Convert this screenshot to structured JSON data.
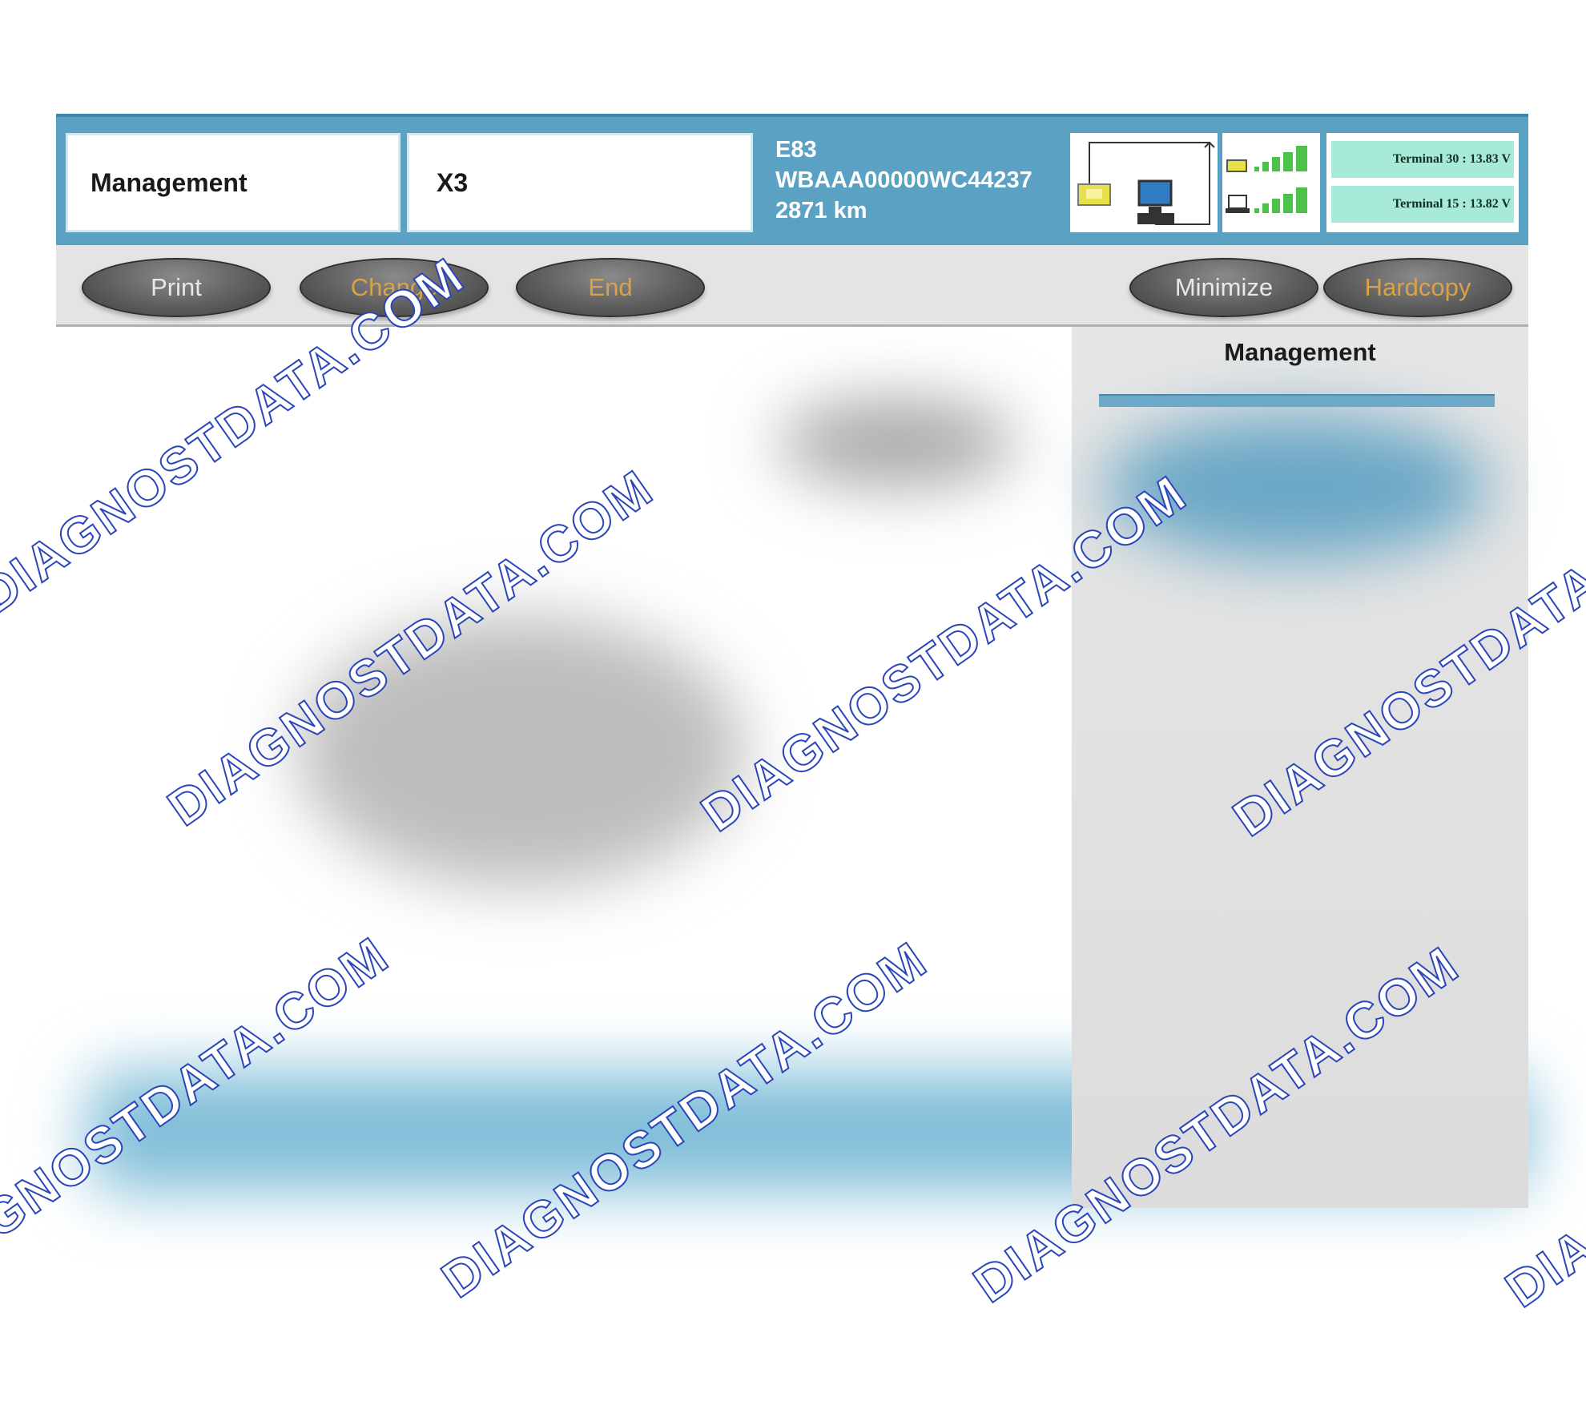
{
  "header": {
    "area_label": "Management",
    "model_label": "X3",
    "vehicle": {
      "series": "E83",
      "vin": "WBAAA00000WC44237",
      "mileage": "2871 km"
    },
    "terminal_30": "Terminal 30 : 13.83 V",
    "terminal_15": "Terminal 15 : 13.82 V"
  },
  "toolbar": {
    "print_label": "Print",
    "change_label": "Change",
    "end_label": "End",
    "minimize_label": "Minimize",
    "hardcopy_label": "Hardcopy"
  },
  "side_panel": {
    "title": "Management"
  },
  "watermark": {
    "text": "DIAGNOSTDATA.COM"
  },
  "colors": {
    "header_blue": "#5aa1c4",
    "button_text_orange": "#d8a24a",
    "terminal_green": "#a7ead9",
    "signal_green": "#4cc24a",
    "watermark_outline": "#2b46b8"
  }
}
